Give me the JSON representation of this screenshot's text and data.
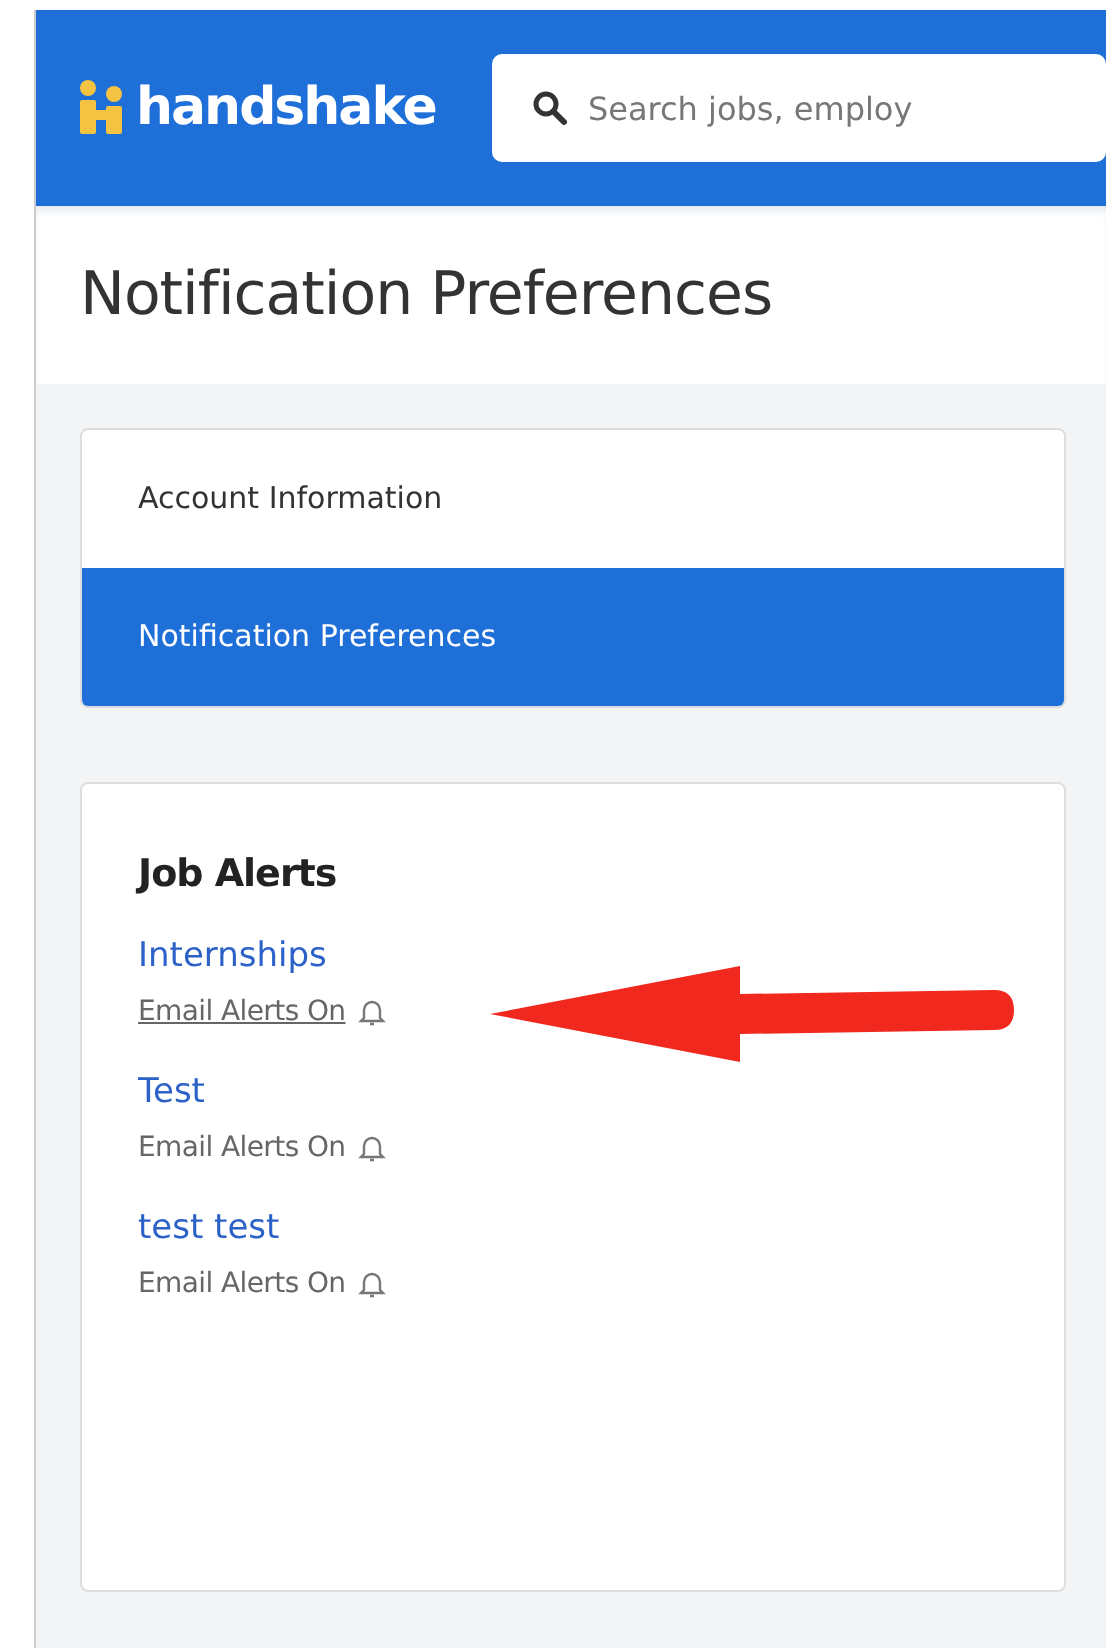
{
  "header": {
    "logo": "handshake",
    "search": {
      "placeholder": "Search jobs, employ"
    }
  },
  "page_title": "Notification Preferences",
  "nav": [
    {
      "label": "Account Information",
      "selected": false
    },
    {
      "label": "Notification Preferences",
      "selected": true
    }
  ],
  "job_alerts": {
    "title": "Job Alerts",
    "alerts": [
      {
        "name": "Internships",
        "status": "Email Alerts On",
        "hovered": true,
        "annotated": true
      },
      {
        "name": "Test",
        "status": "Email Alerts On",
        "hovered": false,
        "annotated": false
      },
      {
        "name": "test test",
        "status": "Email Alerts On",
        "hovered": false,
        "annotated": false
      }
    ]
  }
}
